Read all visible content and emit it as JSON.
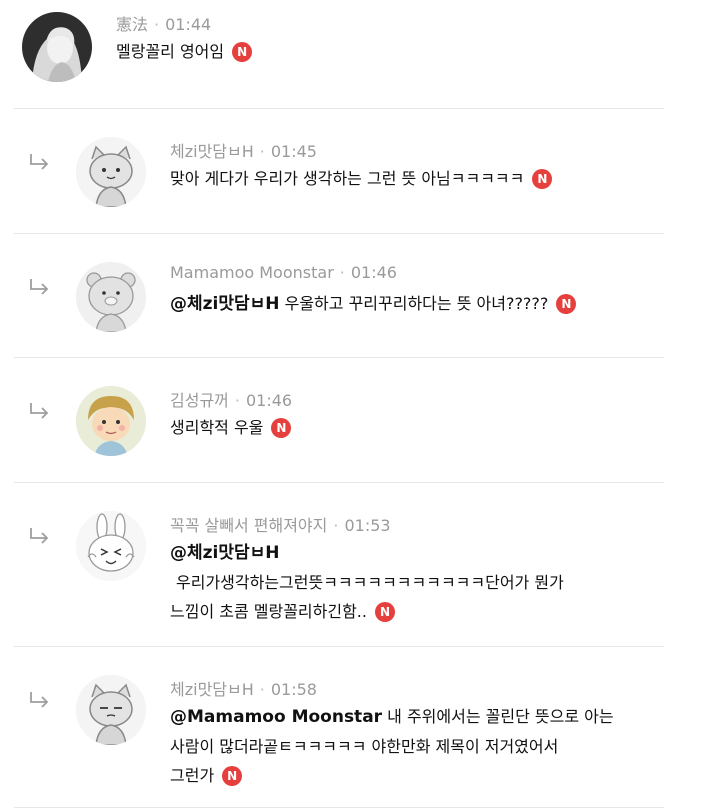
{
  "new_badge": "N",
  "comments": [
    {
      "author": "憲法",
      "time": "01:44",
      "text": "멜랑꼴리 영어임",
      "avatar": "portrait-photo"
    },
    {
      "author": "체zi맛담ㅂH",
      "time": "01:45",
      "text": "맞아 게다가 우리가 생각하는 그런 뜻 아님ㅋㅋㅋㅋㅋ",
      "avatar": "cartoon-cat"
    },
    {
      "author": "Mamamoo Moonstar",
      "time": "01:46",
      "mention": "@체zi맛담ㅂH",
      "text": "우울하고 꾸리꾸리하다는 뜻 아녀?????",
      "avatar": "cartoon-bear"
    },
    {
      "author": "김성규꺼",
      "time": "01:46",
      "text": "생리학적 우울",
      "avatar": "cartoon-boy"
    },
    {
      "author": "꼭꼭 살빼서 편해져야지",
      "time": "01:53",
      "mention": "@체zi맛담ㅂH",
      "text_line1": "우리가생각하는그런뜻ㅋㅋㅋㅋㅋㅋㅋㅋㅋㅋㅋ단어가 뭔가",
      "text_line2": "느낌이 초콤 멜랑꼴리하긴함..",
      "avatar": "cartoon-rabbit"
    },
    {
      "author": "체zi맛담ㅂH",
      "time": "01:58",
      "mention": "@Mamamoo Moonstar",
      "text_line1": "내 주위에서는 꼴린단 뜻으로 아는",
      "text_line2": "사람이 많더라곹ㅌㅋㅋㅋㅋㅋ 야한만화 제목이 저거였어서",
      "text_line3": "그런가",
      "avatar": "cartoon-cat"
    }
  ]
}
